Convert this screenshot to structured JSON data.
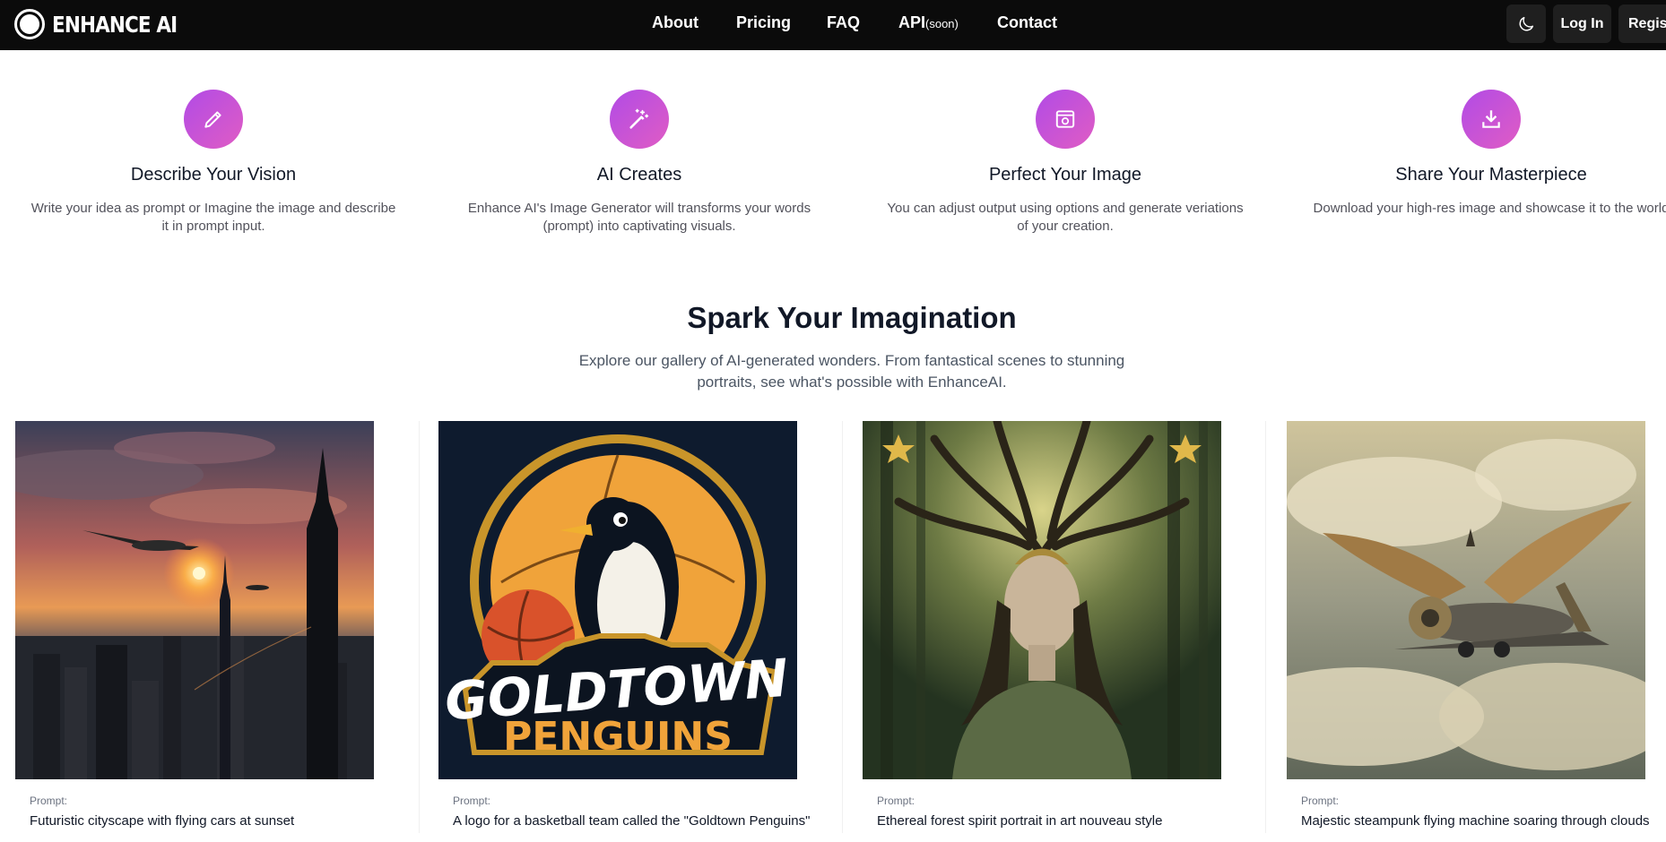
{
  "nav": {
    "brand": "ENHANCE AI",
    "links": [
      "About",
      "Pricing",
      "FAQ",
      "API",
      "Contact"
    ],
    "api_suffix": "(soon)",
    "theme_toggle_icon": "moon-icon",
    "login_label": "Log In",
    "register_label": "Regist"
  },
  "steps": [
    {
      "icon": "pencil-icon",
      "title": "Describe Your Vision",
      "desc": "Write your idea as prompt or Imagine the image and describe it in prompt input."
    },
    {
      "icon": "magic-wand-icon",
      "title": "AI Creates",
      "desc": "Enhance AI's Image Generator will transforms your words (prompt) into captivating visuals."
    },
    {
      "icon": "image-settings-icon",
      "title": "Perfect Your Image",
      "desc": "You can adjust output using options and generate veriations of your creation."
    },
    {
      "icon": "download-icon",
      "title": "Share Your Masterpiece",
      "desc": "Download your high-res image and showcase it to the world"
    }
  ],
  "spark": {
    "title": "Spark Your Imagination",
    "desc": "Explore our gallery of AI-generated wonders. From fantastical scenes to stunning portraits, see what's possible with EnhanceAI."
  },
  "gallery": [
    {
      "label": "Prompt:",
      "prompt": "Futuristic cityscape with flying cars at sunset"
    },
    {
      "label": "Prompt:",
      "prompt": "A logo for a basketball team called the \"Goldtown Penguins\"",
      "logo_line1": "GOLDTOWN",
      "logo_line2": "PENGUINS"
    },
    {
      "label": "Prompt:",
      "prompt": "Ethereal forest spirit portrait in art nouveau style"
    },
    {
      "label": "Prompt:",
      "prompt": "Majestic steampunk flying machine soaring through clouds"
    }
  ],
  "colors": {
    "nav_bg": "#0b0b0b",
    "accent_start": "#b14be6",
    "accent_end": "#e05cc4"
  }
}
